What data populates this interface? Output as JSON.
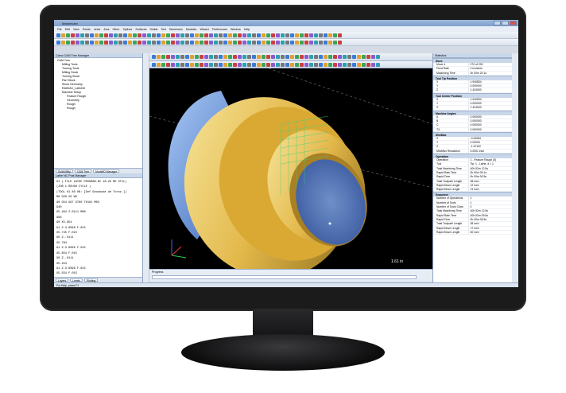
{
  "app": {
    "title": "Mastercam"
  },
  "menu": [
    "File",
    "Edit",
    "View",
    "Points",
    "Lines",
    "Arcs",
    "Other",
    "Splines",
    "Surfaces",
    "Solids",
    "Text",
    "Dimension",
    "Modules",
    "Wizard",
    "Preferences",
    "Window",
    "Help"
  ],
  "left_panel": {
    "title": "Camo CAM Tree Manager",
    "tree": [
      "CAM Tree",
      "Milling Tools",
      "Turning Tools",
      "Milling Stock",
      "Turning Stock",
      "Part Stock",
      "Stock Geometry",
      "RAW/AC_Lathe/fe",
      "Machine Setup",
      "Feature Rough",
      "Geometry",
      "Rough",
      "Rough"
    ],
    "tabs": [
      "SolidUtility",
      "CAM Tree",
      "ModelID Manager"
    ],
    "nc_title": "Lathe NC Post Manager",
    "nc_lines": [
      "O1 ( FILE LATHE PROGRAM.NC 16:25 ME STIL)",
      "(JOB 1 ROUGH CYCLE )",
      "(TOOL 01 80 ON: [Def Geodonde de Torno ])",
      "M6 G28 U0 W0",
      "G0 G54 G97 S780 T0101 M03",
      "G40",
      "X5.404 Z.0111 M08",
      "G96",
      "G0 X5.954",
      "G1 Z-3.6096 F.015",
      "X5.745 F.015",
      "G0 Z-.0111",
      "X5.784",
      "G1 Z-3.6096 F.015",
      "X5.654 F.015",
      "G0 Z-.0111",
      "X5.454",
      "G1 Z-3.6096 F.015",
      "X5.554 F.015"
    ],
    "bottom_tabs": [
      "Layers",
      "Levels",
      "Plotting"
    ]
  },
  "progress_label": "Progress",
  "viewport_ruler": "1.61 in",
  "right_panel": {
    "title": "Statistics",
    "sections": [
      {
        "name": "Move",
        "rows": [
          [
            "Move #",
            "270 of 200"
          ],
          [
            "Feed Rate",
            "0 inch/min"
          ],
          [
            "Machining Time",
            "0h 00m 20.1s"
          ]
        ]
      },
      {
        "name": "Tool Tip Position",
        "rows": [
          [
            "X",
            "1.940834"
          ],
          [
            "Y",
            "0.000000"
          ],
          [
            "Z",
            "1.424000"
          ]
        ]
      },
      {
        "name": "Tool Center Position",
        "rows": [
          [
            "X",
            "1.940834"
          ],
          [
            "Y",
            "0.000000"
          ],
          [
            "Z",
            "1.424000"
          ]
        ]
      },
      {
        "name": "Machine Angles",
        "rows": [
          [
            "A",
            "0.000000"
          ],
          [
            "B",
            "0.000000"
          ],
          [
            "C",
            "0.000000"
          ],
          [
            "TX",
            "0.000000"
          ]
        ]
      },
      {
        "name": "Min/Max",
        "rows": [
          [
            "X",
            "-0.04084"
          ],
          [
            "Y",
            "0.00000"
          ],
          [
            "Z",
            "-1.47102"
          ],
          [
            "Min/Max Resolution",
            "0.0001 inch"
          ]
        ]
      },
      {
        "name": "Operation",
        "rows": [
          [
            "Operation",
            "1 - Feature Rough (0)"
          ],
          [
            "Tool",
            "Tip: 1 - Lathe, d = 1"
          ],
          [
            "Total Machining Time",
            "40h 52m 12.5s"
          ],
          [
            "Rapid Rate Time",
            "0h 00m 05.1s"
          ],
          [
            "Rapid Time",
            "0h 00m 00.5s"
          ],
          [
            "Total Toolpath Length",
            "38 inch"
          ],
          [
            "Rapid Move Length",
            "12 inch"
          ],
          [
            "Rapid Move Length",
            "21 inch"
          ]
        ]
      },
      {
        "name": "Sequence",
        "rows": [
          [
            "Number of Operations",
            "1"
          ],
          [
            "Number of Tools",
            "1"
          ],
          [
            "Number of Tools Chan",
            "0"
          ],
          [
            "Total Machining Time",
            "40h 52m 12.5s"
          ],
          [
            "Rapid Rate Time",
            "40h 52m 05.5s"
          ],
          [
            "Rapid Time",
            "0h 00m 05.5s"
          ],
          [
            "Total Toolpath Length",
            "38 inch"
          ],
          [
            "Rapid Move Length",
            "17 inch"
          ],
          [
            "Rapid Move Length",
            "40 inch"
          ]
        ]
      }
    ]
  },
  "status": "For Help, press F1",
  "colors": {
    "face": "#e8c25a",
    "chuck": "#5f8fd8",
    "bg": "#000000"
  }
}
